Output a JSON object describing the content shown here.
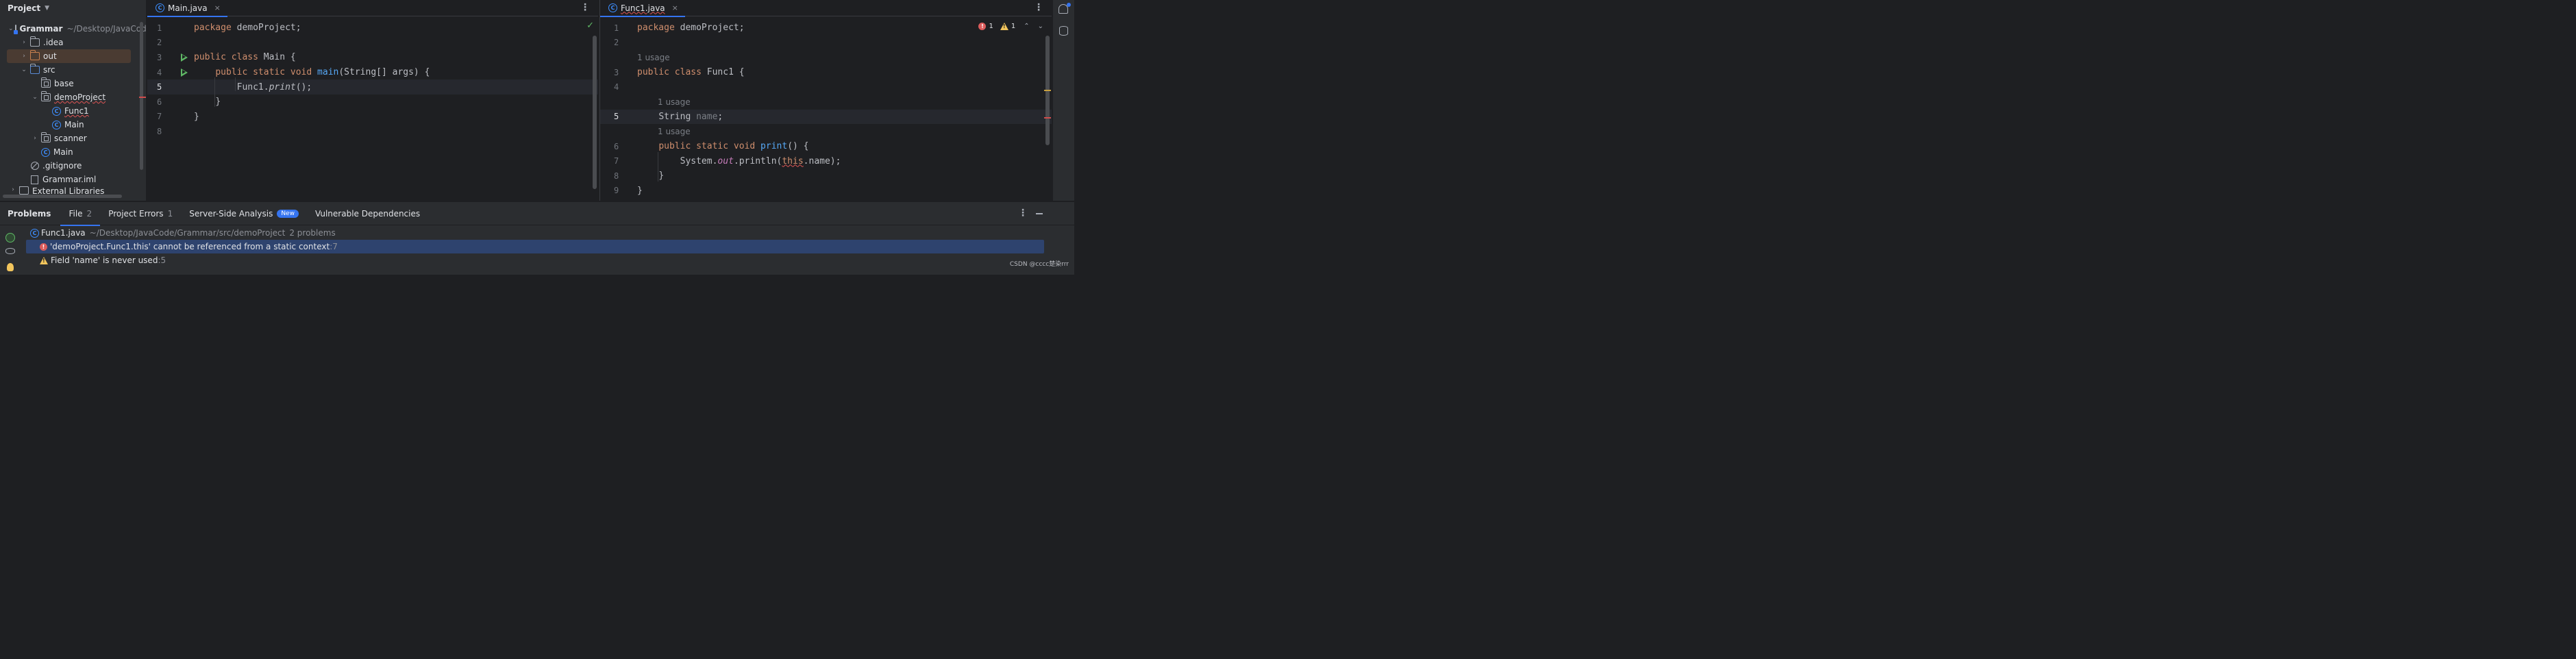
{
  "project_panel": {
    "title": "Project",
    "tree": [
      {
        "label": "Grammar",
        "path": "~/Desktop/JavaCode",
        "type": "module",
        "arrow": "down",
        "bold": true
      },
      {
        "label": ".idea",
        "type": "folder",
        "arrow": "right"
      },
      {
        "label": "out",
        "type": "folder-orange",
        "arrow": "right",
        "selected": true
      },
      {
        "label": "src",
        "type": "folder",
        "arrow": "down"
      },
      {
        "label": "base",
        "type": "package"
      },
      {
        "label": "demoProject",
        "type": "package",
        "arrow": "down",
        "error": true
      },
      {
        "label": "Func1",
        "type": "class",
        "error": true
      },
      {
        "label": "Main",
        "type": "class"
      },
      {
        "label": "scanner",
        "type": "package",
        "arrow": "right"
      },
      {
        "label": "Main",
        "type": "class"
      },
      {
        "label": ".gitignore",
        "type": "gitignore"
      },
      {
        "label": "Grammar.iml",
        "type": "iml"
      },
      {
        "label": "External Libraries",
        "type": "library",
        "arrow": "right"
      }
    ]
  },
  "editor_left": {
    "tab": {
      "label": "Main.java",
      "close": "×"
    },
    "more": "⋮",
    "line_numbers": [
      "1",
      "2",
      "3",
      "4",
      "5",
      "6",
      "7",
      "8"
    ],
    "code": {
      "l1_kw": "package",
      "l1_rest": " demoProject;",
      "l3_kw1": "public",
      "l3_kw2": "class",
      "l3_rest": " Main {",
      "l4_kw1": "public",
      "l4_kw2": "static",
      "l4_kw3": "void",
      "l4_fn": "main",
      "l4_rest": "(String[] args) {",
      "l5_obj": "Func1.",
      "l5_method": "print",
      "l5_rest": "();",
      "l6": "}",
      "l7": "}"
    },
    "status_icon": "check-icon",
    "status_glyph": "✓"
  },
  "editor_right": {
    "tab": {
      "label": "Func1.java",
      "close": "×"
    },
    "more": "⋮",
    "inspections": {
      "errors": "1",
      "warnings": "1",
      "up": "⌃",
      "down": "⌄"
    },
    "code": {
      "l1_num": "1",
      "l1_kw": "package",
      "l1_rest": " demoProject;",
      "l2_num": "2",
      "hint1": "1 usage",
      "l3_num": "3",
      "l3_kw1": "public",
      "l3_kw2": "class",
      "l3_rest": " Func1 {",
      "l4_num": "4",
      "hint2": "1 usage",
      "l5_num": "5",
      "l5_type": "String",
      "l5_field": "name",
      "l5_semi": ";",
      "hint3": "1 usage",
      "l6_num": "6",
      "l6_kw1": "public",
      "l6_kw2": "static",
      "l6_kw3": "void",
      "l6_fn": "print",
      "l6_rest": "() {",
      "l7_num": "7",
      "l7_a": "System.",
      "l7_out": "out",
      "l7_b": ".println(",
      "l7_this": "this",
      "l7_c": ".name);",
      "l8_num": "8",
      "l8": "}",
      "l9_num": "9",
      "l9": "}"
    }
  },
  "problems_panel": {
    "tabs": {
      "title": "Problems",
      "file": "File",
      "file_count": "2",
      "project_errors": "Project Errors",
      "project_errors_count": "1",
      "server_side": "Server-Side Analysis",
      "new_badge": "New",
      "vulnerable": "Vulnerable Dependencies"
    },
    "more": "⋮",
    "file_row": {
      "name": "Func1.java",
      "path": "~/Desktop/JavaCode/Grammar/src/demoProject",
      "count": "2 problems"
    },
    "issues": [
      {
        "severity": "error",
        "message": "'demoProject.Func1.this' cannot be referenced from a static context",
        "location": " :7"
      },
      {
        "severity": "warning",
        "message": "Field 'name' is never used",
        "location": " :5"
      }
    ],
    "watermark": "CSDN @cccc楚染rrr"
  },
  "colors": {
    "background": "#1e1f22",
    "panel": "#2b2d30",
    "keyword": "#cf8e6d",
    "function": "#56a8f5",
    "field": "#c77dbb",
    "accent": "#3574f0",
    "error": "#db5c5c",
    "warning": "#f2c55c",
    "run": "#5fb865"
  }
}
